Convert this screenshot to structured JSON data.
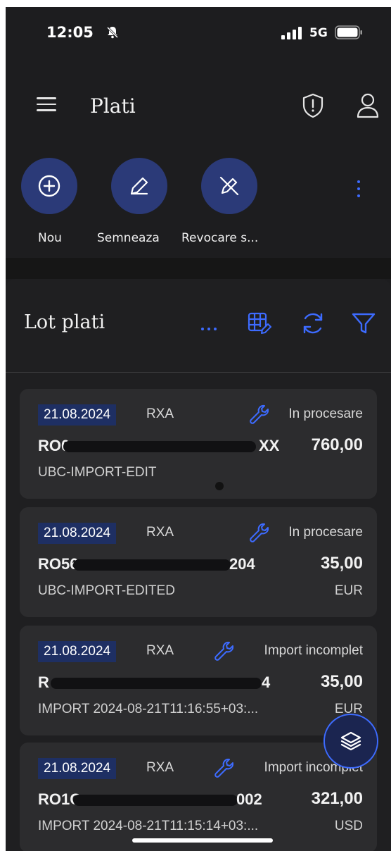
{
  "status_bar": {
    "time": "12:05",
    "network": "5G"
  },
  "header": {
    "title": "Plati"
  },
  "actions": [
    {
      "label": "Nou",
      "icon": "plus-circle-icon"
    },
    {
      "label": "Semneaza",
      "icon": "pen-icon"
    },
    {
      "label": "Revocare s...",
      "icon": "pen-off-icon"
    }
  ],
  "panel": {
    "title": "Lot plati",
    "tools": [
      "more-icon",
      "table-edit-icon",
      "refresh-icon",
      "filter-icon"
    ]
  },
  "payments": [
    {
      "date": "21.08.2024",
      "code": "RXA",
      "status": "In procesare",
      "iban_visible": "RO0",
      "iban_tail": "XX",
      "amount": "760,00",
      "description": "UBC-IMPORT-EDIT",
      "currency": ""
    },
    {
      "date": "21.08.2024",
      "code": "RXA",
      "status": "In procesare",
      "iban_visible": "RO56",
      "iban_tail": "204",
      "amount": "35,00",
      "description": "UBC-IMPORT-EDITED",
      "currency": "EUR"
    },
    {
      "date": "21.08.2024",
      "code": "RXA",
      "status": "Import incomplet",
      "iban_visible": "R",
      "iban_tail": "4",
      "amount": "35,00",
      "description": "IMPORT 2024-08-21T11:16:55+03:...",
      "currency": "EUR"
    },
    {
      "date": "21.08.2024",
      "code": "RXA",
      "status": "Import incomplet",
      "iban_visible": "RO1C",
      "iban_tail": "002",
      "amount": "321,00",
      "description": "IMPORT 2024-08-21T11:15:14+03:...",
      "currency": "USD"
    }
  ],
  "colors": {
    "accent": "#3d6bff",
    "action_circle": "#2b3a78",
    "date_badge": "#1e2f63",
    "card": "#2c2c2e",
    "background": "#1d1d1f"
  }
}
